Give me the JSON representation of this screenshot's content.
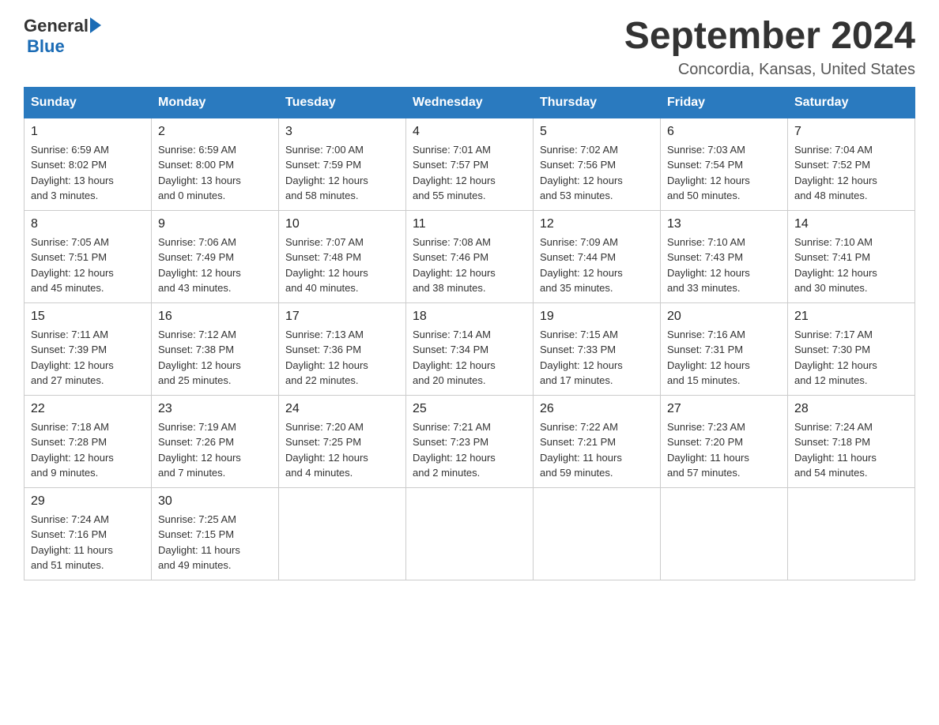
{
  "header": {
    "logo_general": "General",
    "logo_blue": "Blue",
    "month_title": "September 2024",
    "location": "Concordia, Kansas, United States"
  },
  "weekdays": [
    "Sunday",
    "Monday",
    "Tuesday",
    "Wednesday",
    "Thursday",
    "Friday",
    "Saturday"
  ],
  "weeks": [
    [
      {
        "day": "1",
        "info": "Sunrise: 6:59 AM\nSunset: 8:02 PM\nDaylight: 13 hours\nand 3 minutes."
      },
      {
        "day": "2",
        "info": "Sunrise: 6:59 AM\nSunset: 8:00 PM\nDaylight: 13 hours\nand 0 minutes."
      },
      {
        "day": "3",
        "info": "Sunrise: 7:00 AM\nSunset: 7:59 PM\nDaylight: 12 hours\nand 58 minutes."
      },
      {
        "day": "4",
        "info": "Sunrise: 7:01 AM\nSunset: 7:57 PM\nDaylight: 12 hours\nand 55 minutes."
      },
      {
        "day": "5",
        "info": "Sunrise: 7:02 AM\nSunset: 7:56 PM\nDaylight: 12 hours\nand 53 minutes."
      },
      {
        "day": "6",
        "info": "Sunrise: 7:03 AM\nSunset: 7:54 PM\nDaylight: 12 hours\nand 50 minutes."
      },
      {
        "day": "7",
        "info": "Sunrise: 7:04 AM\nSunset: 7:52 PM\nDaylight: 12 hours\nand 48 minutes."
      }
    ],
    [
      {
        "day": "8",
        "info": "Sunrise: 7:05 AM\nSunset: 7:51 PM\nDaylight: 12 hours\nand 45 minutes."
      },
      {
        "day": "9",
        "info": "Sunrise: 7:06 AM\nSunset: 7:49 PM\nDaylight: 12 hours\nand 43 minutes."
      },
      {
        "day": "10",
        "info": "Sunrise: 7:07 AM\nSunset: 7:48 PM\nDaylight: 12 hours\nand 40 minutes."
      },
      {
        "day": "11",
        "info": "Sunrise: 7:08 AM\nSunset: 7:46 PM\nDaylight: 12 hours\nand 38 minutes."
      },
      {
        "day": "12",
        "info": "Sunrise: 7:09 AM\nSunset: 7:44 PM\nDaylight: 12 hours\nand 35 minutes."
      },
      {
        "day": "13",
        "info": "Sunrise: 7:10 AM\nSunset: 7:43 PM\nDaylight: 12 hours\nand 33 minutes."
      },
      {
        "day": "14",
        "info": "Sunrise: 7:10 AM\nSunset: 7:41 PM\nDaylight: 12 hours\nand 30 minutes."
      }
    ],
    [
      {
        "day": "15",
        "info": "Sunrise: 7:11 AM\nSunset: 7:39 PM\nDaylight: 12 hours\nand 27 minutes."
      },
      {
        "day": "16",
        "info": "Sunrise: 7:12 AM\nSunset: 7:38 PM\nDaylight: 12 hours\nand 25 minutes."
      },
      {
        "day": "17",
        "info": "Sunrise: 7:13 AM\nSunset: 7:36 PM\nDaylight: 12 hours\nand 22 minutes."
      },
      {
        "day": "18",
        "info": "Sunrise: 7:14 AM\nSunset: 7:34 PM\nDaylight: 12 hours\nand 20 minutes."
      },
      {
        "day": "19",
        "info": "Sunrise: 7:15 AM\nSunset: 7:33 PM\nDaylight: 12 hours\nand 17 minutes."
      },
      {
        "day": "20",
        "info": "Sunrise: 7:16 AM\nSunset: 7:31 PM\nDaylight: 12 hours\nand 15 minutes."
      },
      {
        "day": "21",
        "info": "Sunrise: 7:17 AM\nSunset: 7:30 PM\nDaylight: 12 hours\nand 12 minutes."
      }
    ],
    [
      {
        "day": "22",
        "info": "Sunrise: 7:18 AM\nSunset: 7:28 PM\nDaylight: 12 hours\nand 9 minutes."
      },
      {
        "day": "23",
        "info": "Sunrise: 7:19 AM\nSunset: 7:26 PM\nDaylight: 12 hours\nand 7 minutes."
      },
      {
        "day": "24",
        "info": "Sunrise: 7:20 AM\nSunset: 7:25 PM\nDaylight: 12 hours\nand 4 minutes."
      },
      {
        "day": "25",
        "info": "Sunrise: 7:21 AM\nSunset: 7:23 PM\nDaylight: 12 hours\nand 2 minutes."
      },
      {
        "day": "26",
        "info": "Sunrise: 7:22 AM\nSunset: 7:21 PM\nDaylight: 11 hours\nand 59 minutes."
      },
      {
        "day": "27",
        "info": "Sunrise: 7:23 AM\nSunset: 7:20 PM\nDaylight: 11 hours\nand 57 minutes."
      },
      {
        "day": "28",
        "info": "Sunrise: 7:24 AM\nSunset: 7:18 PM\nDaylight: 11 hours\nand 54 minutes."
      }
    ],
    [
      {
        "day": "29",
        "info": "Sunrise: 7:24 AM\nSunset: 7:16 PM\nDaylight: 11 hours\nand 51 minutes."
      },
      {
        "day": "30",
        "info": "Sunrise: 7:25 AM\nSunset: 7:15 PM\nDaylight: 11 hours\nand 49 minutes."
      },
      {
        "day": "",
        "info": ""
      },
      {
        "day": "",
        "info": ""
      },
      {
        "day": "",
        "info": ""
      },
      {
        "day": "",
        "info": ""
      },
      {
        "day": "",
        "info": ""
      }
    ]
  ]
}
